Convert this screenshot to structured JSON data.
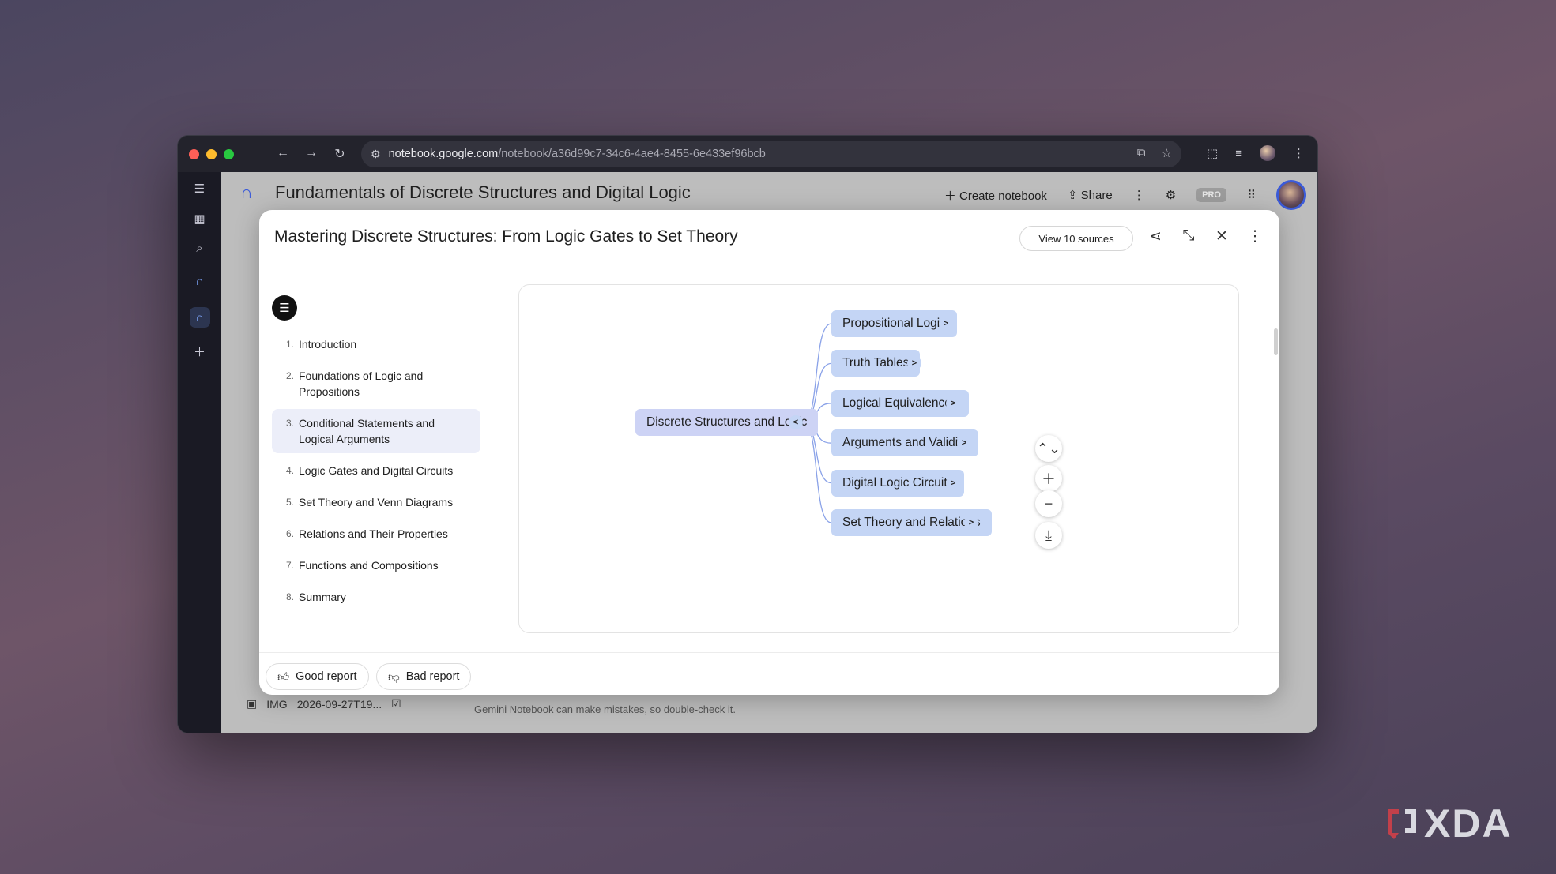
{
  "browser": {
    "url_host": "notebook.google.com",
    "url_path": "/notebook/a36d99c7-34c6-4ae4-8455-6e433ef96bcb"
  },
  "app": {
    "notebook_title": "Fundamentals of Discrete Structures and Digital Logic",
    "create_notebook_label": "Create notebook",
    "share_label": "Share",
    "pro_badge": "PRO",
    "background_source_label": "IMG",
    "background_source_name": "2026-09-27T19...",
    "disclaimer": "Gemini Notebook can make mistakes, so double-check it."
  },
  "modal": {
    "title": "Mastering Discrete Structures: From Logic Gates to Set Theory",
    "view_sources_label": "View 10 sources",
    "toc": [
      {
        "num": "1.",
        "label": "Introduction"
      },
      {
        "num": "2.",
        "label": "Foundations of Logic and Propositions"
      },
      {
        "num": "3.",
        "label": "Conditional Statements and Logical Arguments"
      },
      {
        "num": "4.",
        "label": "Logic Gates and Digital Circuits"
      },
      {
        "num": "5.",
        "label": "Set Theory and Venn Diagrams"
      },
      {
        "num": "6.",
        "label": "Relations and Their Properties"
      },
      {
        "num": "7.",
        "label": "Functions and Compositions"
      },
      {
        "num": "8.",
        "label": "Summary"
      }
    ],
    "active_toc_index": 2,
    "mindmap": {
      "root": "Discrete Structures and Logic",
      "root_toggle": "<",
      "children": [
        {
          "label": "Propositional Logic",
          "toggle": ">"
        },
        {
          "label": "Truth Tables",
          "toggle": ">"
        },
        {
          "label": "Logical Equivalences",
          "toggle": ">"
        },
        {
          "label": "Arguments and Validity",
          "toggle": ">"
        },
        {
          "label": "Digital Logic Circuits",
          "toggle": ">"
        },
        {
          "label": "Set Theory and Relations",
          "toggle": ">"
        }
      ]
    },
    "feedback": {
      "good_label": "Good report",
      "bad_label": "Bad report"
    }
  },
  "watermark": {
    "text": "XDA"
  },
  "colors": {
    "node_fill": "#c4d5f5",
    "root_fill": "#cdd3f5",
    "connector": "#8aa2e8",
    "accent": "#3b5bd9"
  }
}
